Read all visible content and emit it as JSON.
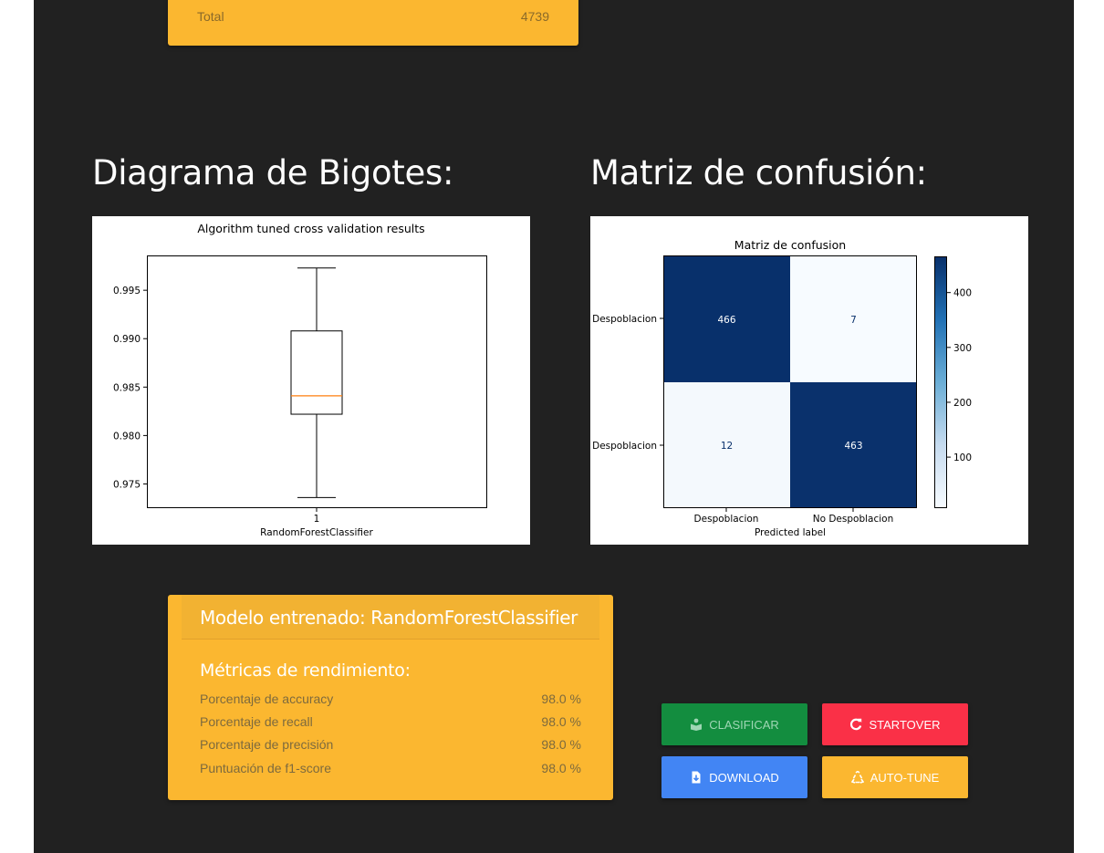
{
  "top_summary": {
    "label": "Total",
    "value": "4739"
  },
  "boxplot": {
    "heading": "Diagrama de Bigotes:",
    "chart_data": {
      "type": "box",
      "title": "Algorithm tuned cross validation results",
      "categories": [
        "1"
      ],
      "xlabel": "RandomForestClassifier",
      "ylabel": "",
      "ylim": [
        0.9725,
        0.9985
      ],
      "yticks": [
        "0.975",
        "0.980",
        "0.985",
        "0.990",
        "0.995"
      ],
      "series": [
        {
          "min": 0.9736,
          "q1": 0.9822,
          "median": 0.9841,
          "q3": 0.9908,
          "max": 0.9973
        }
      ],
      "grid": false,
      "colors": {
        "median": "#ff7f0e",
        "box": "#000000"
      }
    }
  },
  "confusion": {
    "heading": "Matriz de confusión:",
    "chart_data": {
      "type": "heatmap",
      "title": "Matriz de confusion",
      "x_tick_labels": [
        "Despoblacion",
        "No Despoblacion"
      ],
      "y_tick_labels": [
        "Despoblacion",
        "Despoblacion"
      ],
      "xlabel": "Predicted label",
      "ylabel": "",
      "values": [
        [
          466,
          7
        ],
        [
          12,
          463
        ]
      ],
      "colorbar_ticks": [
        "100",
        "200",
        "300",
        "400"
      ],
      "colormap": "Blues",
      "colors": {
        "low": "#f7fbff",
        "high": "#08306b"
      }
    }
  },
  "model": {
    "title": "Modelo entrenado: RandomForestClassifier",
    "metrics_title": "Métricas de rendimiento:",
    "metrics": [
      {
        "label": "Porcentaje de accuracy",
        "value": "98.0 %"
      },
      {
        "label": "Porcentaje de recall",
        "value": "98.0 %"
      },
      {
        "label": "Porcentaje de precisión",
        "value": "98.0 %"
      },
      {
        "label": "Puntuación de f1-score",
        "value": "98.0 %"
      }
    ]
  },
  "buttons": {
    "classify": {
      "label": "CLASIFICAR",
      "icon": "book-reader-icon",
      "color": "#138D3F"
    },
    "startover": {
      "label": "STARTOVER",
      "icon": "redo-icon",
      "color": "#FA3047"
    },
    "download": {
      "label": "DOWNLOAD",
      "icon": "file-download-icon",
      "color": "#4285F4"
    },
    "autotune": {
      "label": "AUTO-TUNE",
      "icon": "recycle-icon",
      "color": "#FBB730"
    }
  }
}
